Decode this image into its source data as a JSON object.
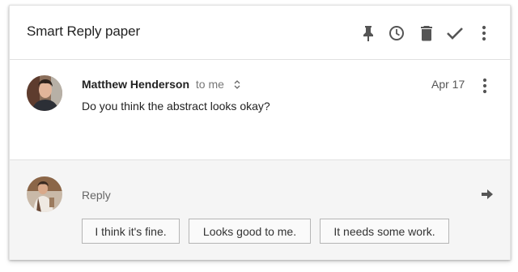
{
  "thread": {
    "subject": "Smart Reply paper",
    "actions": [
      {
        "icon": "pin-icon"
      },
      {
        "icon": "clock-icon"
      },
      {
        "icon": "trash-icon"
      },
      {
        "icon": "check-icon"
      },
      {
        "icon": "more-vert-icon"
      }
    ]
  },
  "message": {
    "sender": "Matthew Henderson",
    "recipient": "to me",
    "date": "Apr 17",
    "body": "Do you think the abstract looks okay?"
  },
  "reply": {
    "label": "Reply",
    "suggestions": [
      "I think it's fine.",
      "Looks good to me.",
      "It needs some work."
    ]
  },
  "colors": {
    "icon": "#555555",
    "reply_background": "#f5f5f5",
    "chip_border": "#b5b5b5"
  }
}
